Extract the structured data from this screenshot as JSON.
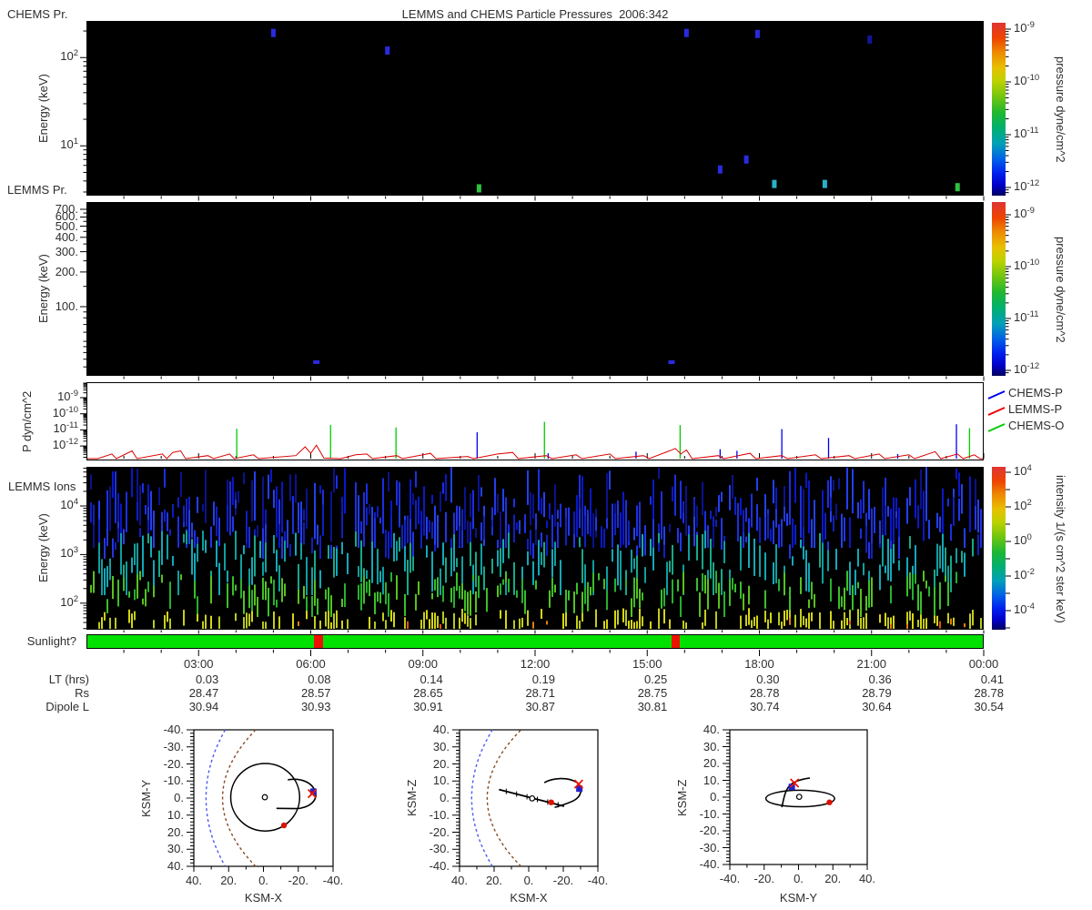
{
  "title": "LEMMS and CHEMS Particle Pressures  2006:342",
  "colors": {
    "background": "#ffffff",
    "panel_bg": "#000000",
    "axis": "#000000",
    "text": "#2e2e2e",
    "sun_on": "#00e100",
    "sun_off": "#ee1100",
    "bow_shock": "#4a5aee",
    "magnetopause": "#8a4a22",
    "marker_cross": "#ee1100",
    "marker_square": "#2222cc",
    "marker_dot": "#dd1100"
  },
  "chart_data": [
    {
      "id": "chems_lemms_pressure_spectrogram",
      "type": "heatmap",
      "title_left_top": "CHEMS Pr.",
      "title_left_bottom": "LEMMS Pr.",
      "ylabel": "Energy (keV)",
      "yscale": "log",
      "ylim_kev": [
        2.7,
        260
      ],
      "ytick_exponents": [
        2,
        1
      ],
      "colorbar": {
        "label": "pressure dyne/cm^2",
        "tick_exponents": [
          -9,
          -10,
          -11,
          -12
        ]
      },
      "points": [
        {
          "hour": 5.0,
          "kev": 190,
          "color": "#2a2ae0"
        },
        {
          "hour": 8.05,
          "kev": 120,
          "color": "#2a2ae0"
        },
        {
          "hour": 16.05,
          "kev": 190,
          "color": "#2a2ae0"
        },
        {
          "hour": 17.95,
          "kev": 185,
          "color": "#2a2ae0"
        },
        {
          "hour": 20.95,
          "kev": 160,
          "color": "#141498"
        },
        {
          "hour": 17.65,
          "kev": 7.0,
          "color": "#2a2ae0"
        },
        {
          "hour": 16.95,
          "kev": 5.4,
          "color": "#2a2ae0"
        },
        {
          "hour": 18.4,
          "kev": 3.7,
          "color": "#29b0c8"
        },
        {
          "hour": 19.75,
          "kev": 3.7,
          "color": "#29b0c8"
        },
        {
          "hour": 10.5,
          "kev": 3.3,
          "color": "#30c040"
        },
        {
          "hour": 23.3,
          "kev": 3.4,
          "color": "#30c040"
        }
      ]
    },
    {
      "id": "lemms_pressure_spectrogram",
      "type": "heatmap",
      "ylabel": "Energy (keV)",
      "yscale": "log",
      "ylim_kev": [
        25,
        810
      ],
      "ytick_values": [
        700,
        600,
        500,
        400,
        300,
        200,
        100
      ],
      "ytick_minor": [
        650,
        550,
        450,
        350,
        250,
        150,
        90,
        80,
        70,
        60,
        50,
        45,
        40,
        35,
        30
      ],
      "colorbar": {
        "label": "pressure dyne/cm^2",
        "tick_exponents": [
          -9,
          -10,
          -11,
          -12
        ]
      },
      "points": [
        {
          "hour": 6.15,
          "kev": 33,
          "color": "#2a2ae0"
        },
        {
          "hour": 15.65,
          "kev": 33,
          "color": "#2a2ae0"
        }
      ]
    },
    {
      "id": "pressure_timeseries",
      "type": "line",
      "ylabel": "P dyn/cm^2",
      "yscale": "log",
      "ytick_exponents": [
        -9,
        -10,
        -11,
        -12
      ],
      "ylim_exponents": [
        -12.85,
        -8.72
      ],
      "legend": [
        {
          "label": "CHEMS-P",
          "color": "#0000ee"
        },
        {
          "label": "LEMMS-P",
          "color": "#ee0000"
        },
        {
          "label": "CHEMS-O",
          "color": "#00cc00"
        }
      ],
      "spikes": [
        {
          "hour": 4.02,
          "log10": -10.93,
          "series": "CHEMS-O"
        },
        {
          "hour": 6.53,
          "log10": -10.69,
          "series": "CHEMS-O"
        },
        {
          "hour": 8.28,
          "log10": -10.85,
          "series": "CHEMS-O"
        },
        {
          "hour": 12.25,
          "log10": -10.5,
          "series": "CHEMS-O"
        },
        {
          "hour": 15.88,
          "log10": -10.7,
          "series": "CHEMS-O"
        },
        {
          "hour": 23.62,
          "log10": -10.9,
          "series": "CHEMS-O"
        },
        {
          "hour": 10.45,
          "log10": -11.15,
          "series": "CHEMS-P"
        },
        {
          "hour": 12.35,
          "log10": -12.45,
          "series": "CHEMS-P"
        },
        {
          "hour": 14.7,
          "log10": -12.35,
          "series": "CHEMS-P"
        },
        {
          "hour": 16.95,
          "log10": -12.2,
          "series": "CHEMS-P"
        },
        {
          "hour": 17.4,
          "log10": -12.3,
          "series": "CHEMS-P"
        },
        {
          "hour": 18.6,
          "log10": -10.95,
          "series": "CHEMS-P"
        },
        {
          "hour": 19.85,
          "log10": -11.5,
          "series": "CHEMS-P"
        },
        {
          "hour": 21.7,
          "log10": -12.5,
          "series": "CHEMS-P"
        },
        {
          "hour": 23.27,
          "log10": -10.65,
          "series": "CHEMS-P"
        }
      ],
      "lemms_trace": [
        [
          0.3,
          -12.8
        ],
        [
          0.68,
          -12.5
        ],
        [
          0.8,
          -12.8
        ],
        [
          1.22,
          -12.3
        ],
        [
          1.35,
          -12.8
        ],
        [
          2.03,
          -12.5
        ],
        [
          2.15,
          -12.8
        ],
        [
          2.31,
          -12.4
        ],
        [
          2.52,
          -12.3
        ],
        [
          2.65,
          -12.8
        ],
        [
          3.25,
          -12.6
        ],
        [
          3.4,
          -12.8
        ],
        [
          3.83,
          -12.5
        ],
        [
          3.95,
          -12.8
        ],
        [
          4.47,
          -12.55
        ],
        [
          4.6,
          -12.8
        ],
        [
          5.6,
          -12.6
        ],
        [
          5.85,
          -12.05
        ],
        [
          6.0,
          -12.45
        ],
        [
          6.15,
          -11.95
        ],
        [
          6.35,
          -12.75
        ],
        [
          6.8,
          -12.8
        ],
        [
          7.2,
          -12.55
        ],
        [
          7.5,
          -12.5
        ],
        [
          7.65,
          -12.8
        ],
        [
          8.3,
          -12.6
        ],
        [
          8.45,
          -12.8
        ],
        [
          9.0,
          -12.55
        ],
        [
          9.2,
          -12.45
        ],
        [
          9.35,
          -12.8
        ],
        [
          10.2,
          -12.65
        ],
        [
          10.35,
          -12.8
        ],
        [
          11.0,
          -12.5
        ],
        [
          11.4,
          -12.4
        ],
        [
          11.55,
          -12.8
        ],
        [
          12.3,
          -12.6
        ],
        [
          12.45,
          -12.8
        ],
        [
          13.1,
          -12.55
        ],
        [
          13.25,
          -12.8
        ],
        [
          14.0,
          -12.5
        ],
        [
          14.15,
          -12.8
        ],
        [
          14.9,
          -12.6
        ],
        [
          15.05,
          -12.8
        ],
        [
          15.6,
          -12.3
        ],
        [
          15.75,
          -12.15
        ],
        [
          15.9,
          -12.5
        ],
        [
          16.05,
          -12.25
        ],
        [
          16.2,
          -12.8
        ],
        [
          16.9,
          -12.6
        ],
        [
          17.05,
          -12.8
        ],
        [
          17.75,
          -12.45
        ],
        [
          17.9,
          -12.8
        ],
        [
          18.6,
          -12.6
        ],
        [
          18.75,
          -12.8
        ],
        [
          19.5,
          -12.55
        ],
        [
          19.65,
          -12.8
        ],
        [
          20.4,
          -12.6
        ],
        [
          20.55,
          -12.8
        ],
        [
          21.2,
          -12.5
        ],
        [
          21.35,
          -12.8
        ],
        [
          22.0,
          -12.55
        ],
        [
          22.15,
          -12.8
        ],
        [
          22.7,
          -12.35
        ],
        [
          22.85,
          -12.8
        ],
        [
          23.3,
          -12.5
        ],
        [
          23.45,
          -12.8
        ],
        [
          23.75,
          -12.55
        ],
        [
          23.9,
          -12.8
        ]
      ]
    },
    {
      "id": "lemms_ions_spectrogram",
      "type": "heatmap",
      "title_left": "LEMMS Ions",
      "ylabel": "Energy (keV)",
      "yscale": "log",
      "ylim_kev": [
        29,
        63000
      ],
      "ytick_exponents": [
        4,
        3,
        2
      ],
      "colorbar": {
        "label": "intensity 1/(s cm^2 ster keV)",
        "tick_exponents": [
          4,
          2,
          0,
          -2,
          -4
        ]
      },
      "texture": {
        "seed": 1234,
        "col_step": 3,
        "gap_p": 0.12,
        "bands": [
          {
            "colors": [
              "#0a18c8",
              "#1c2fe0",
              "#2340ee",
              "#0c128f"
            ],
            "p": 0.85,
            "y": [
              513,
              583
            ],
            "len": [
              8,
              62
            ],
            "clip": 602
          },
          {
            "colors": [
              "#1020c0",
              "#2236e6"
            ],
            "p": 0.5,
            "y": [
              545,
              600
            ],
            "len": [
              6,
              36
            ],
            "clip": 614
          },
          {
            "colors": [
              "#0f9e9e",
              "#12a8b8",
              "#17a88a"
            ],
            "p": 0.6,
            "y": [
              583,
              628
            ],
            "len": [
              8,
              46
            ],
            "clip": 654
          },
          {
            "colors": [
              "#27b02f",
              "#3bbf28",
              "#57c11f"
            ],
            "p": 0.55,
            "y": [
              627,
              659
            ],
            "len": [
              6,
              34
            ],
            "clip": 678
          },
          {
            "colors": [
              "#c6cd1c",
              "#d6d513",
              "#b8c81f"
            ],
            "p": 0.5,
            "y": [
              668,
              684
            ],
            "len": [
              8,
              24
            ],
            "clip": 691
          },
          {
            "colors": [
              "#e07f10",
              "#e05510"
            ],
            "p": 0.05,
            "y": [
              676,
              686
            ],
            "len": [
              4,
              10
            ],
            "clip": 691
          }
        ]
      }
    },
    {
      "id": "sunlight_bar",
      "type": "bar",
      "label": "Sunlight?",
      "on_color": "#00e100",
      "off_color": "#ee1100",
      "off_intervals_hours": [
        [
          6.08,
          6.32
        ],
        [
          15.64,
          15.88
        ]
      ]
    }
  ],
  "timeaxis": {
    "row_labels": [
      "LT (hrs)",
      "Rs",
      "Dipole L"
    ],
    "ticks": [
      {
        "hour": 3,
        "label": "03:00",
        "lt": "0.03",
        "rs": "28.47",
        "dipole_l": "30.94"
      },
      {
        "hour": 6,
        "label": "06:00",
        "lt": "0.08",
        "rs": "28.57",
        "dipole_l": "30.93"
      },
      {
        "hour": 9,
        "label": "09:00",
        "lt": "0.14",
        "rs": "28.65",
        "dipole_l": "30.91"
      },
      {
        "hour": 12,
        "label": "12:00",
        "lt": "0.19",
        "rs": "28.71",
        "dipole_l": "30.87"
      },
      {
        "hour": 15,
        "label": "15:00",
        "lt": "0.25",
        "rs": "28.75",
        "dipole_l": "30.81"
      },
      {
        "hour": 18,
        "label": "18:00",
        "lt": "0.30",
        "rs": "28.78",
        "dipole_l": "30.74"
      },
      {
        "hour": 21,
        "label": "21:00",
        "lt": "0.36",
        "rs": "28.79",
        "dipole_l": "30.64"
      },
      {
        "hour": 24,
        "label": "00:00",
        "lt": "0.41",
        "rs": "28.78",
        "dipole_l": "30.54"
      }
    ]
  },
  "orbits": [
    {
      "xlabel": "KSM-X",
      "ylabel": "KSM-Y",
      "xlim": [
        40,
        -40
      ],
      "ylim": [
        -40,
        40
      ],
      "xtick_labels": [
        "40.",
        "20.",
        "0.",
        "-20.",
        "-40."
      ],
      "ytick_labels": [
        "-40.",
        "-30.",
        "-20.",
        "-10.",
        "0.",
        "10.",
        "20.",
        "30.",
        "40."
      ],
      "bow_shock": {
        "nose": 33,
        "edge": 22
      },
      "magnetopause": {
        "nose": 23.5,
        "edge": 4.5
      },
      "circle": {
        "cx": -1,
        "cy": -0.5,
        "r": 19.8
      },
      "saturn": [
        -0.8,
        -0.5
      ],
      "path": [
        "M",
        -14,
        -10.7,
        "C",
        -22,
        -12,
        -28.5,
        -9,
        -30,
        -3,
        "C",
        -30.8,
        2,
        -26,
        5.8,
        -19,
        6.2,
        "L",
        -7.5,
        6
      ],
      "markers": {
        "cross": [
          -28,
          -2.6
        ],
        "square": [
          -28.7,
          -3.8
        ],
        "dot": [
          -11.8,
          16
        ]
      }
    },
    {
      "xlabel": "KSM-X",
      "ylabel": "KSM-Z",
      "xlim": [
        40,
        -40
      ],
      "ylim": [
        40,
        -40
      ],
      "xtick_labels": [
        "40.",
        "20.",
        "0.",
        "-20.",
        "-40."
      ],
      "ytick_labels": [
        "40.",
        "30.",
        "20.",
        "10.",
        "0.",
        "-10.",
        "-20.",
        "-30.",
        "-40."
      ],
      "bow_shock": {
        "nose": 33,
        "edge": 21
      },
      "magnetopause": {
        "nose": 24,
        "edge": 4.5
      },
      "line": [
        [
          17.2,
          5.0
        ],
        [
          -20.5,
          -4.8
        ]
      ],
      "line_ticks": [
        13,
        7,
        1,
        -5,
        -11,
        -17
      ],
      "saturn": [
        -2,
        -0.2
      ],
      "path": [
        "M",
        -9,
        9,
        "C",
        -14,
        12,
        -23,
        12.5,
        -28,
        9,
        "C",
        -31.5,
        5.5,
        -30.5,
        1,
        -26,
        -1.5,
        "C",
        -22,
        -3.5,
        -18,
        -4.5,
        -15,
        -5.5
      ],
      "markers": {
        "cross": [
          -28.9,
          8.2
        ],
        "square": [
          -29.3,
          5.5
        ],
        "dot": [
          -13,
          -2.5
        ]
      }
    },
    {
      "xlabel": "KSM-Y",
      "ylabel": "KSM-Z",
      "xlim": [
        -40,
        40
      ],
      "ylim": [
        40,
        -40
      ],
      "xtick_labels": [
        "-40.",
        "-20.",
        "0.",
        "20.",
        "40."
      ],
      "ytick_labels": [
        "40.",
        "30.",
        "20.",
        "10.",
        "0.",
        "-10.",
        "-20.",
        "-30.",
        "-40."
      ],
      "ellipse": {
        "cx": 1,
        "cy": -0.8,
        "rx": 20,
        "ry": 4.9
      },
      "saturn": [
        0.4,
        0.2
      ],
      "path": [
        "M",
        6.6,
        11.4,
        "C",
        2.5,
        10.8,
        -3,
        9.6,
        -5.6,
        6.4,
        "C",
        -8.2,
        3,
        -8.8,
        -2,
        -9.7,
        -6
      ],
      "markers": {
        "cross": [
          -2.3,
          8.4
        ],
        "square": [
          -3.9,
          6.1
        ],
        "dot": [
          18,
          -3.1
        ]
      }
    }
  ]
}
